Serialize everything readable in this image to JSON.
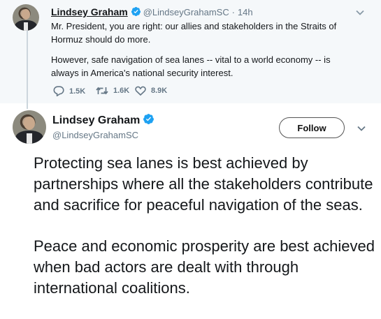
{
  "reply_tweet": {
    "author_name": "Lindsey Graham",
    "author_handle": "@LindseyGrahamSC",
    "separator": "·",
    "time": "14h",
    "paragraphs": [
      "Mr. President, you are right: our allies and stakeholders in the Straits of Hormuz should do more.",
      "However, safe navigation of sea lanes -- vital to a world economy -- is always in America's national security interest."
    ],
    "stats": {
      "replies": "1.5K",
      "retweets": "1.6K",
      "likes": "8.9K"
    }
  },
  "main_tweet": {
    "author_name": "Lindsey Graham",
    "author_handle": "@LindseyGrahamSC",
    "follow_label": "Follow",
    "paragraphs": [
      "Protecting sea lanes is best achieved by partnerships where all the stakeholders contribute and sacrifice for peaceful navigation of the seas.",
      "Peace and economic prosperity are best achieved when bad actors are dealt with through international coalitions."
    ]
  },
  "colors": {
    "verified_blue": "#1da1f2",
    "secondary_text": "#657786",
    "thread_line": "#ccd6dd",
    "top_background": "#f5f8fa"
  },
  "icons": [
    "verified-icon",
    "chevron-down-icon",
    "reply-icon",
    "retweet-icon",
    "like-icon"
  ]
}
